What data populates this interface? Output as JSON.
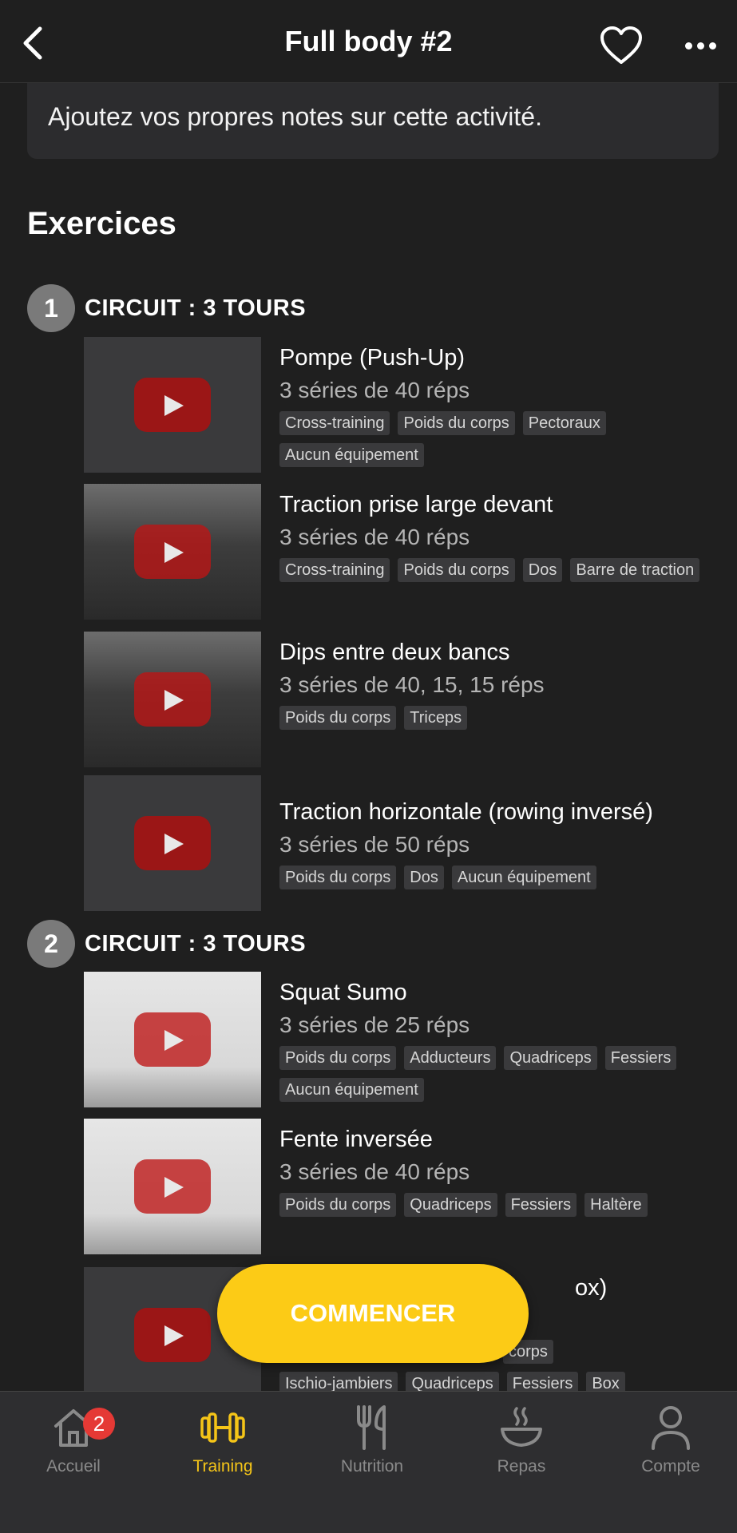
{
  "header": {
    "title": "Full body #2"
  },
  "notes": {
    "placeholder": "Ajoutez vos propres notes sur cette activité."
  },
  "section_title": "Exercices",
  "circuits": [
    {
      "number": "1",
      "label": "CIRCUIT : 3 TOURS",
      "exercises": [
        {
          "name": "Pompe (Push-Up)",
          "sets": "3 séries de 40 réps",
          "tags": [
            "Cross-training",
            "Poids du corps",
            "Pectoraux",
            "Aucun équipement"
          ]
        },
        {
          "name": "Traction prise large devant",
          "sets": "3 séries de 40 réps",
          "tags": [
            "Cross-training",
            "Poids du corps",
            "Dos",
            "Barre de traction"
          ]
        },
        {
          "name": "Dips entre deux bancs",
          "sets": "3 séries de 40, 15, 15 réps",
          "tags": [
            "Poids du corps",
            "Triceps"
          ]
        },
        {
          "name": "Traction horizontale (rowing inversé)",
          "sets": "3 séries de 50 réps",
          "tags": [
            "Poids du corps",
            "Dos",
            "Aucun équipement"
          ]
        }
      ]
    },
    {
      "number": "2",
      "label": "CIRCUIT : 3 TOURS",
      "exercises": [
        {
          "name": "Squat Sumo",
          "sets": "3 séries de 25 réps",
          "tags": [
            "Poids du corps",
            "Adducteurs",
            "Quadriceps",
            "Fessiers",
            "Aucun équipement"
          ]
        },
        {
          "name": "Fente inversée",
          "sets": "3 séries de 40 réps",
          "tags": [
            "Poids du corps",
            "Quadriceps",
            "Fessiers",
            "Haltère"
          ]
        },
        {
          "name": "ox)",
          "sets": "",
          "tags": [
            "corps",
            "Ischio-jambiers",
            "Quadriceps",
            "Fessiers",
            "Box"
          ]
        }
      ]
    }
  ],
  "cta_label": "COMMENCER",
  "tabbar": {
    "items": [
      {
        "label": "Accueil",
        "icon": "home-icon",
        "badge": "2"
      },
      {
        "label": "Training",
        "icon": "dumbbell-icon"
      },
      {
        "label": "Nutrition",
        "icon": "fork-knife-icon"
      },
      {
        "label": "Repas",
        "icon": "bowl-icon"
      },
      {
        "label": "Compte",
        "icon": "user-icon"
      }
    ],
    "active_color": "#f5c518",
    "inactive_color": "#8a8a8a"
  },
  "colors": {
    "cta": "#fccb16",
    "background": "#1f1f1f",
    "badge": "#e53935"
  }
}
